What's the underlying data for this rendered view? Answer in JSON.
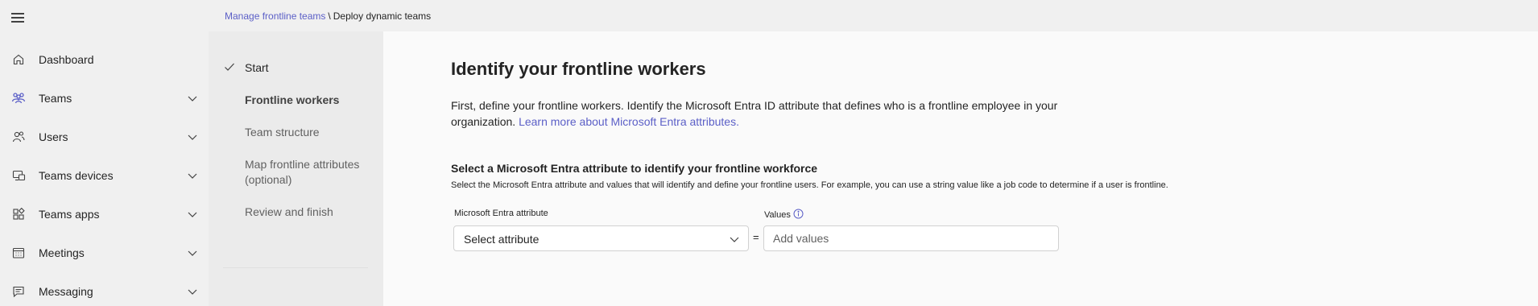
{
  "nav": {
    "items": [
      {
        "label": "Dashboard",
        "icon": "home-icon",
        "expandable": false
      },
      {
        "label": "Teams",
        "icon": "teams-icon",
        "expandable": true
      },
      {
        "label": "Users",
        "icon": "users-icon",
        "expandable": true
      },
      {
        "label": "Teams devices",
        "icon": "devices-icon",
        "expandable": true
      },
      {
        "label": "Teams apps",
        "icon": "apps-icon",
        "expandable": true
      },
      {
        "label": "Meetings",
        "icon": "calendar-icon",
        "expandable": true
      },
      {
        "label": "Messaging",
        "icon": "chat-icon",
        "expandable": true
      }
    ]
  },
  "breadcrumb": {
    "parent": "Manage frontline teams",
    "separator": "\\",
    "current": "Deploy dynamic teams"
  },
  "steps": [
    {
      "label": "Start",
      "state": "done"
    },
    {
      "label": "Frontline workers",
      "state": "active"
    },
    {
      "label": "Team structure",
      "state": "pending"
    },
    {
      "label": "Map frontline attributes (optional)",
      "state": "pending"
    },
    {
      "label": "Review and finish",
      "state": "pending"
    }
  ],
  "main": {
    "title": "Identify your frontline workers",
    "intro_text": "First, define your frontline workers. Identify the Microsoft Entra ID attribute that defines who is a frontline employee in your organization.",
    "intro_link": "Learn more about Microsoft Entra attributes.",
    "section_title": "Select a Microsoft Entra attribute to identify your frontline workforce",
    "section_desc": "Select the Microsoft Entra attribute and values that will identify and define your frontline users. For example, you can use a string value like a job code to determine if a user is frontline.",
    "attribute_label": "Microsoft Entra attribute",
    "attribute_value": "Select attribute",
    "equals": "=",
    "values_label": "Values",
    "values_placeholder": "Add values"
  },
  "colors": {
    "accent": "#5b5fc7",
    "nav_bg": "#f0f0f0",
    "steps_bg": "#ebebeb",
    "main_bg": "#fafafa"
  }
}
